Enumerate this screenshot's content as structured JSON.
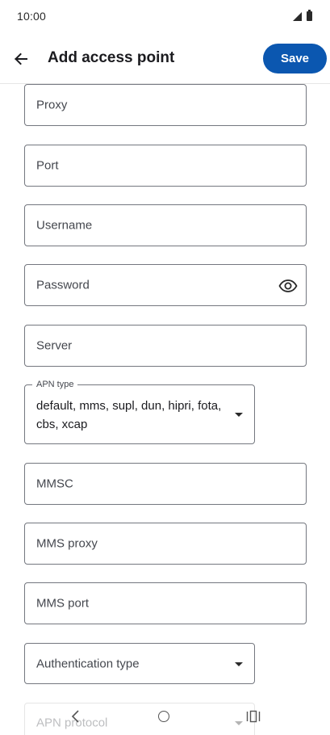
{
  "status_bar": {
    "time": "10:00"
  },
  "app_bar": {
    "back_icon": "arrow-back-icon",
    "title": "Add access point",
    "save_label": "Save"
  },
  "form": {
    "proxy_label": "Proxy",
    "port_label": "Port",
    "username_label": "Username",
    "password_label": "Password",
    "password_visibility_icon": "eye-icon",
    "server_label": "Server",
    "apn_type_label": "APN type",
    "apn_type_value": "default, mms, supl, dun, hipri, fota, cbs, xcap",
    "mmsc_label": "MMSC",
    "mms_proxy_label": "MMS proxy",
    "mms_port_label": "MMS port",
    "authentication_type_label": "Authentication type",
    "apn_protocol_label": "APN protocol"
  },
  "nav_bar": {
    "back_icon": "nav-back-icon",
    "home_icon": "nav-home-icon",
    "recents_icon": "nav-recents-icon"
  },
  "colors": {
    "accent": "#0b57b0",
    "outline": "#74777f",
    "text": "#1b1b1f"
  }
}
